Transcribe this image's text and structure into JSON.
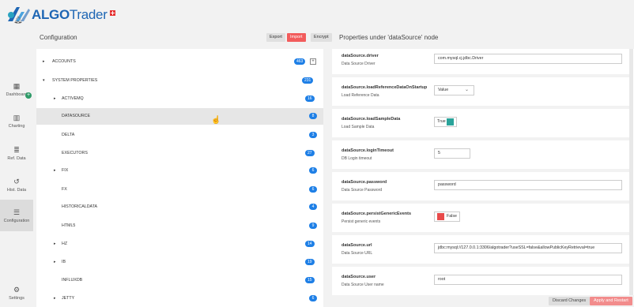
{
  "brand": {
    "name_bold": "ALGO",
    "name_rest": "Trader"
  },
  "sidebar": {
    "items": [
      {
        "label": "Dashboard",
        "icon": "grid-icon"
      },
      {
        "label": "Charting",
        "icon": "bar-chart-icon"
      },
      {
        "label": "Ref. Data",
        "icon": "database-icon"
      },
      {
        "label": "Hist. Data",
        "icon": "history-icon"
      },
      {
        "label": "Configuration",
        "icon": "sliders-icon"
      },
      {
        "label": "Settings",
        "icon": "gear-icon"
      }
    ]
  },
  "config": {
    "title": "Configuration",
    "export_label": "Export",
    "import_label": "Import",
    "encrypt_label": "Encrypt",
    "tree": [
      {
        "label": "ACCOUNTS",
        "count": "463",
        "caret": "▸"
      },
      {
        "label": "SYSTEM PROPERTIES",
        "count": "231",
        "caret": "▾"
      },
      {
        "label": "ACTIVEMQ",
        "count": "16",
        "caret": "▸"
      },
      {
        "label": "DATASOURCE",
        "count": "8",
        "caret": ""
      },
      {
        "label": "DELTA",
        "count": "3",
        "caret": ""
      },
      {
        "label": "EXECUTORS",
        "count": "27",
        "caret": ""
      },
      {
        "label": "FIX",
        "count": "6",
        "caret": "▸"
      },
      {
        "label": "FX",
        "count": "6",
        "caret": ""
      },
      {
        "label": "HISTORICALDATA",
        "count": "4",
        "caret": ""
      },
      {
        "label": "HTML5",
        "count": "9",
        "caret": ""
      },
      {
        "label": "HZ",
        "count": "14",
        "caret": "▸"
      },
      {
        "label": "IB",
        "count": "19",
        "caret": "▸"
      },
      {
        "label": "INFLUXDB",
        "count": "15",
        "caret": ""
      },
      {
        "label": "JETTY",
        "count": "6",
        "caret": "▸"
      }
    ]
  },
  "properties": {
    "title": "Properties under 'dataSource' node",
    "items": [
      {
        "key": "dataSource.driver",
        "desc": "Data Source Driver",
        "value": "com.mysql.cj.jdbc.Driver"
      },
      {
        "key": "dataSource.loadReferenceDataOnStartup",
        "desc": "Load Reference Data",
        "value": "Value"
      },
      {
        "key": "dataSource.loadSampleData",
        "desc": "Load Sample Data",
        "value": "True"
      },
      {
        "key": "dataSource.loginTimeout",
        "desc": "DB Login timeout",
        "value": "5"
      },
      {
        "key": "dataSource.password",
        "desc": "Data Source Password",
        "value": "password"
      },
      {
        "key": "dataSource.persistGenericEvents",
        "desc": "Persist generic events",
        "value": "False"
      },
      {
        "key": "dataSource.url",
        "desc": "Data Source URL",
        "value": "jdbc:mysql://127.0.0.1:3306/algotrader?useSSL=false&allowPublicKeyRetrieval=true"
      },
      {
        "key": "dataSource.user",
        "desc": "Data Source User name",
        "value": "root"
      }
    ]
  },
  "footer": {
    "discard_label": "Discard Changes",
    "apply_label": "Apply and Restart"
  },
  "colors": {
    "brand_blue": "#1e66b4",
    "badge_blue": "#1e7fe6",
    "toggle_true": "#2aa39a",
    "toggle_false": "#e84a4a",
    "accent_red": "#f25c5c"
  }
}
